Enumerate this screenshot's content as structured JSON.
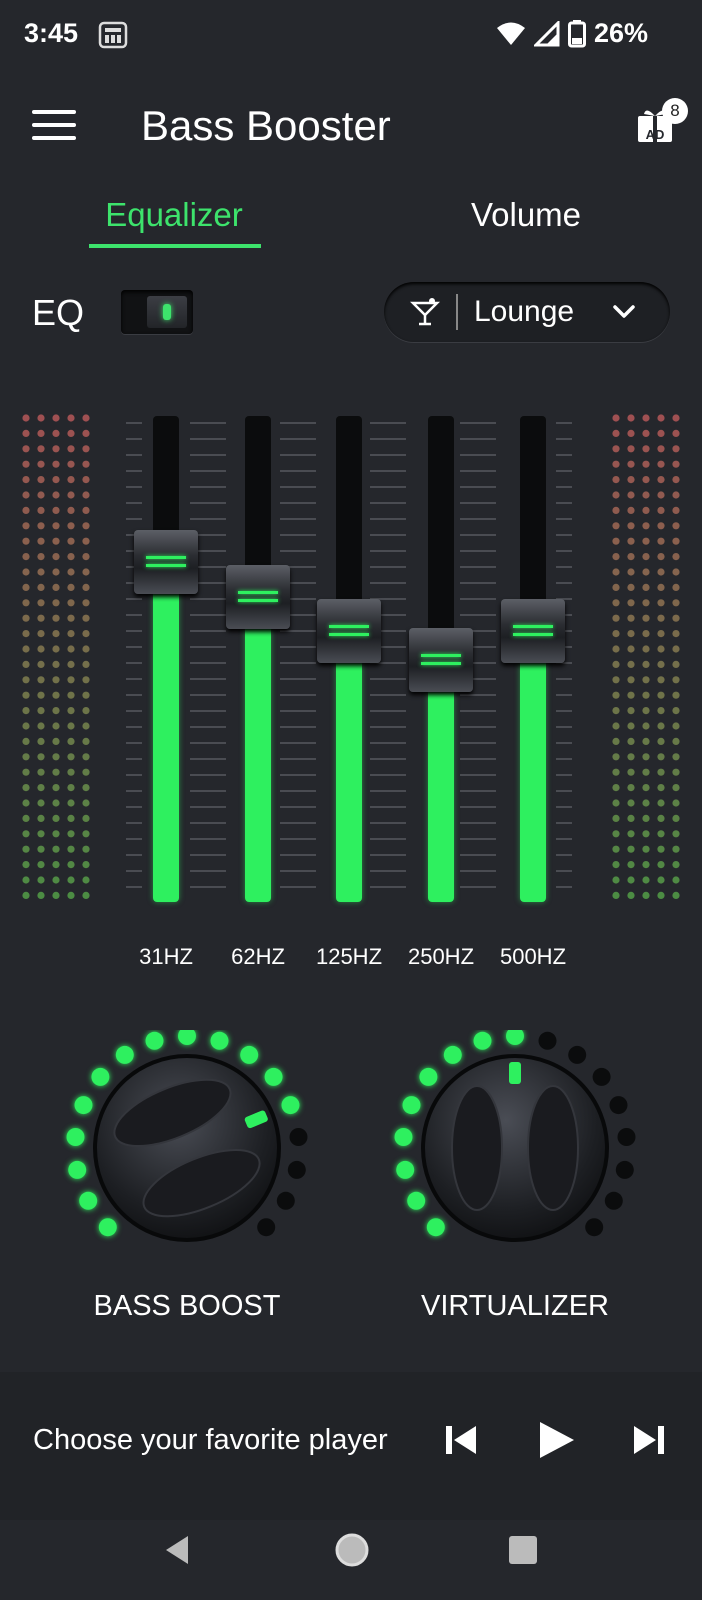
{
  "status": {
    "time": "3:45",
    "battery": "26%"
  },
  "app": {
    "title": "Bass Booster",
    "ad_count": "8",
    "ad_text": "AD"
  },
  "tabs": [
    {
      "label": "Equalizer",
      "selected": true
    },
    {
      "label": "Volume",
      "selected": false
    }
  ],
  "eq": {
    "label": "EQ",
    "enabled": true,
    "preset": "Lounge",
    "preset_icon": "cocktail-icon"
  },
  "bands": [
    {
      "label": "31HZ",
      "level": 0.64
    },
    {
      "label": "62HZ",
      "level": 0.57
    },
    {
      "label": "125HZ",
      "level": 0.5
    },
    {
      "label": "250HZ",
      "level": 0.44
    },
    {
      "label": "500HZ",
      "level": 0.5
    }
  ],
  "knobs": [
    {
      "label": "BASS BOOST",
      "level": 0.75
    },
    {
      "label": "VIRTUALIZER",
      "level": 0.5
    }
  ],
  "player": {
    "prompt": "Choose your favorite player"
  },
  "colors": {
    "accent": "#3de36c",
    "background": "#25272c"
  }
}
